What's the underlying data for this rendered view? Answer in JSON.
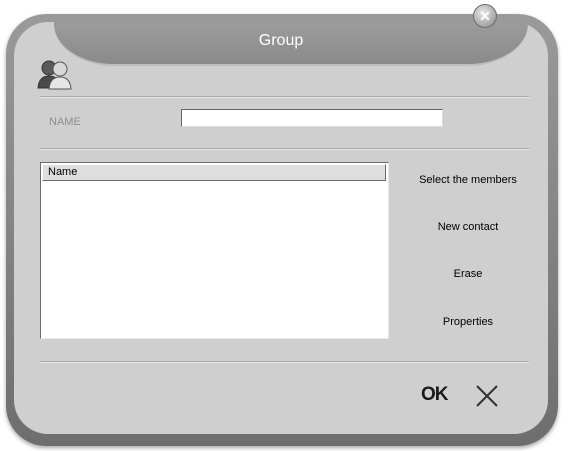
{
  "window": {
    "title": "Group"
  },
  "icons": {
    "avatar": "contacts-group-icon",
    "close": "close-icon",
    "cancel": "cancel-x-icon"
  },
  "form": {
    "name_label": "NAME",
    "name_value": "",
    "list_header": "Name",
    "list_items": []
  },
  "actions": {
    "select_members": "Select the members",
    "new_contact": "New contact",
    "erase": "Erase",
    "properties": "Properties",
    "ok": "OK"
  },
  "colors": {
    "frame": "#7c7c7c",
    "panel": "#cfcfcf",
    "title_text": "#ffffff",
    "label_text": "#8f8f8f"
  }
}
